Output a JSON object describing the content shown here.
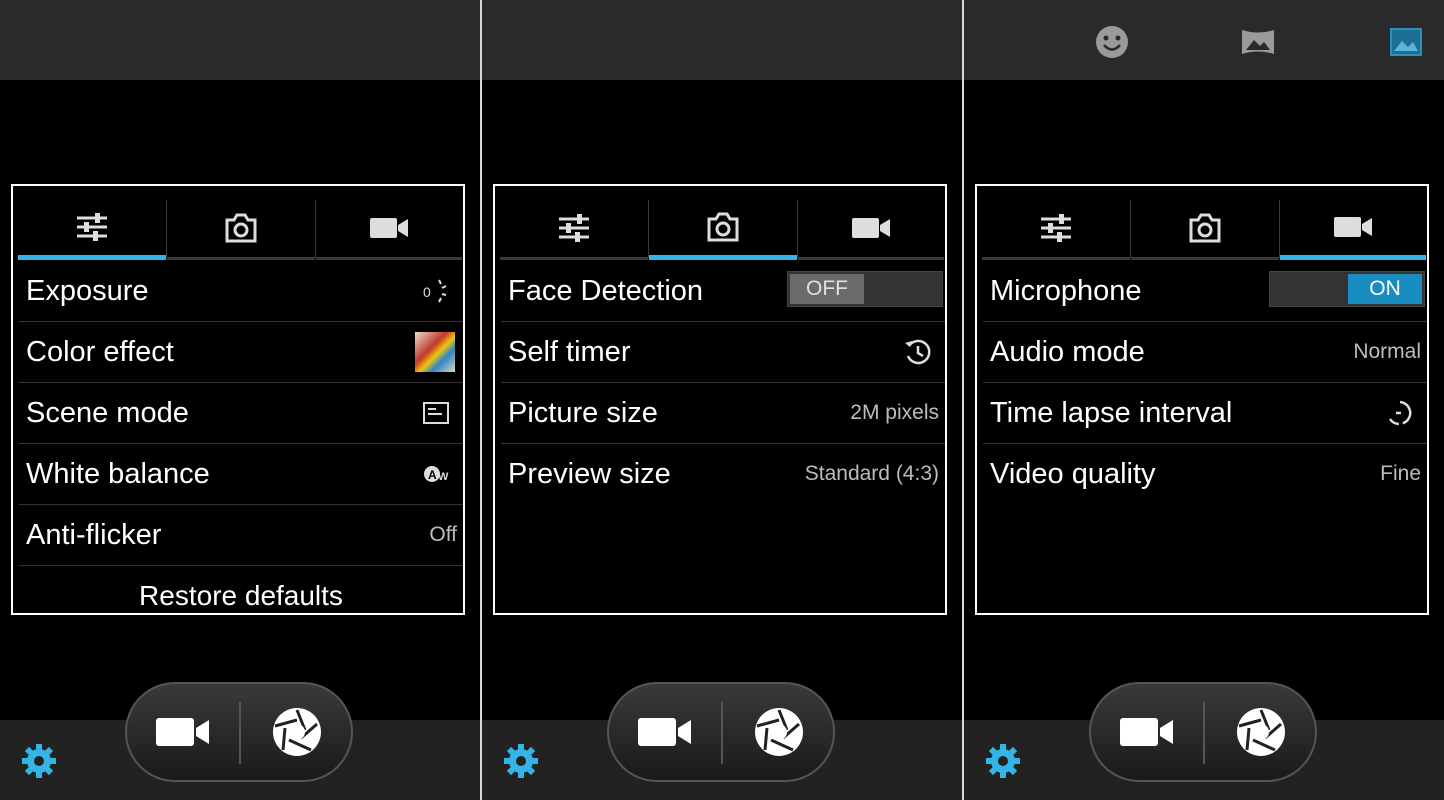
{
  "colors": {
    "accent": "#33b5e5",
    "toggle_on": "#1a8dc0",
    "panel_border": "#ffffff"
  },
  "tab_icons": [
    "sliders-icon",
    "camera-icon",
    "video-camera-icon"
  ],
  "screens": [
    {
      "active_tab": 0,
      "rows": [
        {
          "label": "Exposure",
          "icon": "exposure-icon"
        },
        {
          "label": "Color effect",
          "icon": "color-effect-thumbnail"
        },
        {
          "label": "Scene mode",
          "icon": "scene-mode-icon"
        },
        {
          "label": "White balance",
          "icon": "auto-white-balance-icon"
        },
        {
          "label": "Anti-flicker",
          "value": "Off"
        }
      ],
      "restore_label": "Restore defaults"
    },
    {
      "active_tab": 1,
      "rows": [
        {
          "label": "Face Detection",
          "toggle": "OFF"
        },
        {
          "label": "Self timer",
          "icon": "timer-icon"
        },
        {
          "label": "Picture size",
          "value": "2M pixels"
        },
        {
          "label": "Preview size",
          "value": "Standard (4:3)"
        }
      ]
    },
    {
      "active_tab": 2,
      "top_mode_icons": [
        "face-icon",
        "panorama-icon",
        "picture-mode-icon"
      ],
      "rows": [
        {
          "label": "Microphone",
          "toggle": "ON"
        },
        {
          "label": "Audio mode",
          "value": "Normal"
        },
        {
          "label": "Time lapse interval",
          "icon": "time-lapse-icon"
        },
        {
          "label": "Video quality",
          "value": "Fine"
        }
      ]
    }
  ],
  "bottom_controls": [
    "video-record-icon",
    "shutter-icon",
    "settings-gear-icon"
  ]
}
